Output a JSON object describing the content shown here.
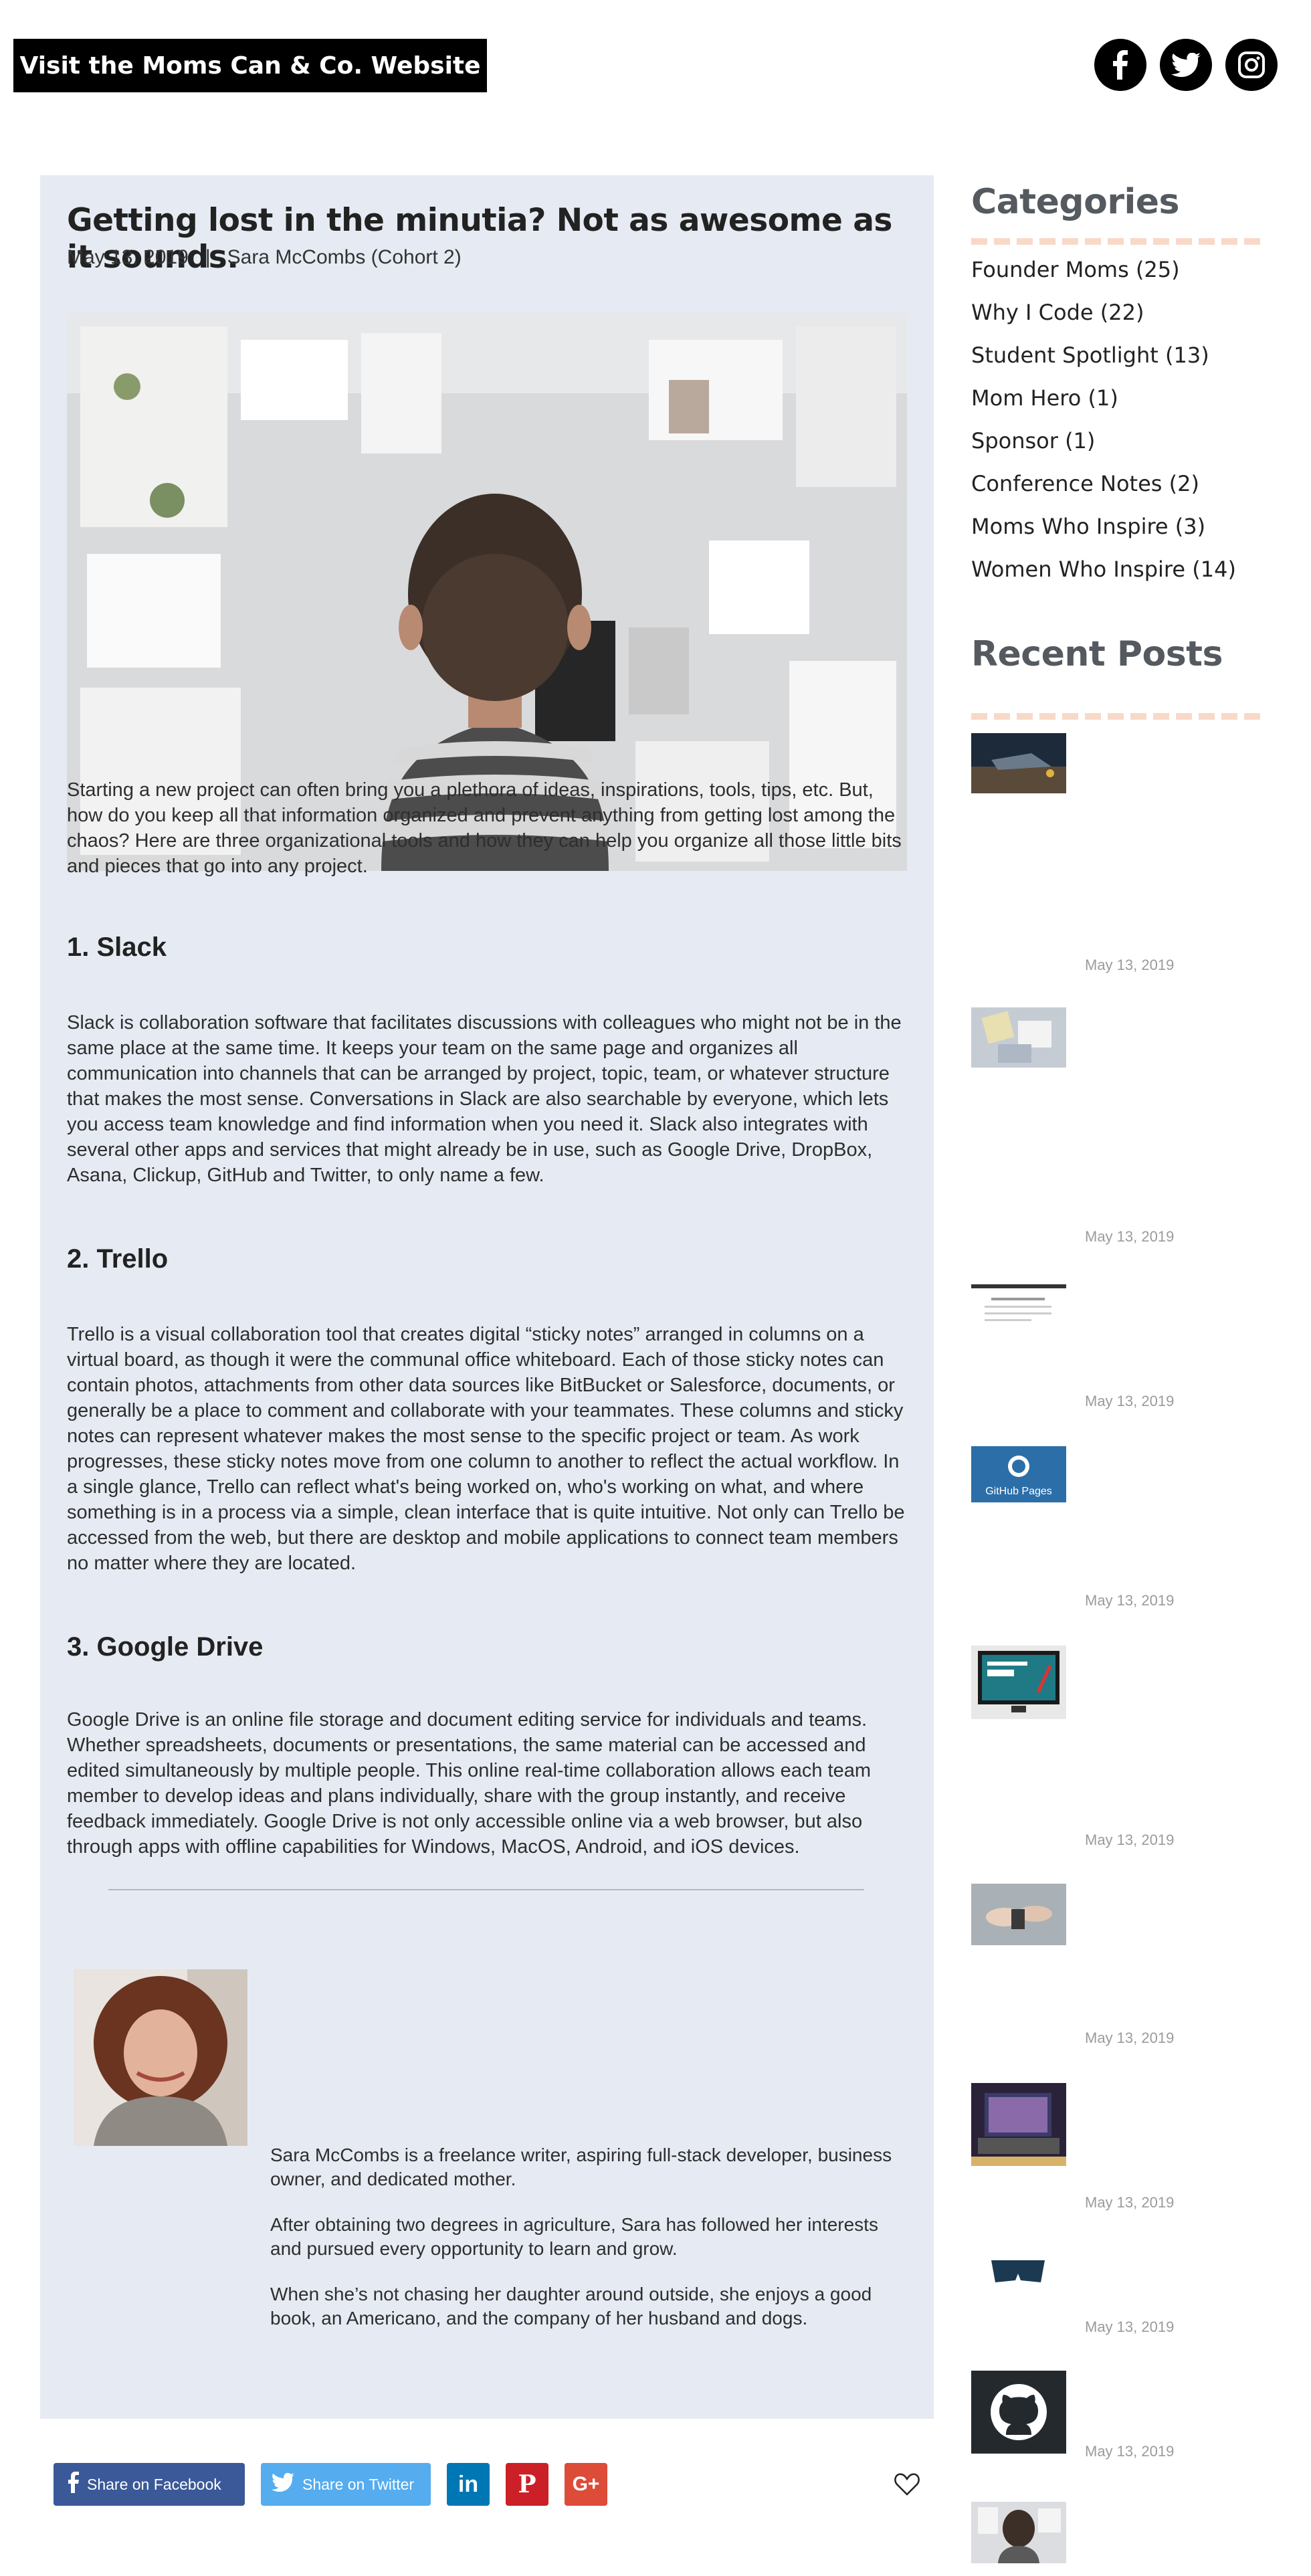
{
  "top_bar": {
    "website_button": "Visit the Moms Can & Co. Website",
    "social_icons": [
      "facebook-icon",
      "twitter-icon",
      "instagram-icon"
    ]
  },
  "article": {
    "title": "Getting lost in the minutia? Not as awesome as it sounds.",
    "date": "May 13, 2019",
    "separator": "|",
    "author": "Sara McCombs (Cohort 2)",
    "intro": "Starting a new project can often bring you a plethora of ideas, inspirations, tools, tips, etc. But, how do you keep all that information organized and prevent anything from getting lost among the chaos? Here are three organizational tools and how they can help you organize all those little bits and pieces that go into any project.",
    "sections": [
      {
        "heading": "1. Slack",
        "body": "Slack is collaboration software that facilitates discussions with colleagues who might not be in the same place at the same time. It keeps your team on the same page and organizes all communication into channels that can be arranged by project, topic, team, or whatever structure that makes the most sense. Conversations in Slack are also searchable by everyone, which lets you access team knowledge and find information when you need it. Slack also integrates with several other apps and services that might already be in use, such as Google Drive, DropBox, Asana, Clickup, GitHub and Twitter, to only name a few."
      },
      {
        "heading": "2. Trello",
        "body": "Trello is a visual collaboration tool that creates digital “sticky notes” arranged in columns on a virtual board, as though it were the communal office whiteboard. Each of those sticky notes can contain photos, attachments from other data sources like BitBucket or Salesforce, documents, or generally be a place to comment and collaborate with your teammates. These columns and sticky notes can represent whatever makes the most sense to the specific project or team. As work progresses, these sticky notes move from one column to another to reflect the actual workflow. In a single glance, Trello can reflect what's being worked on, who's working on what, and where something is in a process via a simple, clean interface that is quite intuitive. Not only can Trello be accessed from the web, but there are desktop and mobile applications to connect team members no matter where they are located."
      },
      {
        "heading": "3. Google Drive",
        "body": "Google Drive is an online file storage and document editing service for individuals and teams. Whether spreadsheets, documents or presentations, the same material can be accessed and edited simultaneously by multiple people. This online real-time collaboration allows each team member to develop ideas and plans individually, share with the group instantly, and receive feedback immediately. Google Drive is not only accessible online via a web browser, but also through apps with offline capabilities for Windows, MacOS, Android, and iOS devices."
      }
    ],
    "bio": [
      "Sara McCombs is a freelance writer, aspiring full-stack developer, business owner, and dedicated mother.",
      "After obtaining two degrees in agriculture, Sara has followed her interests and pursued every opportunity to learn and grow.",
      "When she’s not chasing her daughter around outside, she enjoys a good book, an Americano, and the company of her husband and dogs."
    ]
  },
  "share": {
    "facebook": "Share on Facebook",
    "twitter": "Share on Twitter",
    "linkedin": "in",
    "pinterest": "P",
    "googleplus": "G+"
  },
  "colors": {
    "article_bg": "#e6ebf3",
    "facebook": "#3b5998",
    "twitter": "#55acee",
    "linkedin": "#0077b5",
    "pinterest": "#cb2027",
    "googleplus": "#dd4b39",
    "sidebar_heading": "#555a60",
    "dash": "#f8d9c8"
  },
  "sidebar": {
    "categories_title": "Categories",
    "categories": [
      "Founder Moms (25)",
      "Why I Code (22)",
      "Student Spotlight (13)",
      "Mom Hero (1)",
      "Sponsor (1)",
      "Conference Notes (2)",
      "Moms Who Inspire (3)",
      "Women Who Inspire (14)"
    ],
    "recent_title": "Recent Posts",
    "recent_dates": [
      "May 13, 2019",
      "May 13, 2019",
      "May 13, 2019",
      "May 13, 2019",
      "May 13, 2019",
      "May 13, 2019",
      "May 13, 2019",
      "May 13, 2019",
      "May 13, 2019"
    ],
    "thumb_texts": {
      "github_pages": "GitHub Pages"
    }
  }
}
